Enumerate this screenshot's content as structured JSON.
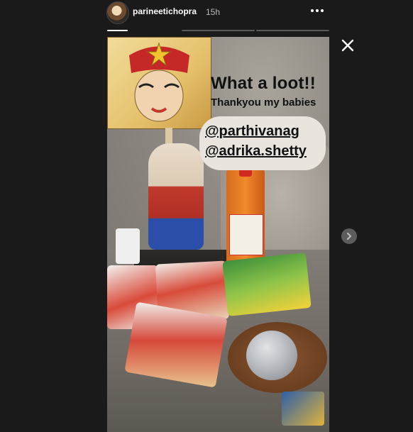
{
  "header": {
    "username": "parineetichopra",
    "time_ago": "15h",
    "more_icon": "more-horizontal-icon",
    "progress": [
      1.0,
      0.0,
      0.0
    ]
  },
  "controls": {
    "close_icon": "close-icon",
    "next_icon": "chevron-right-icon"
  },
  "story": {
    "caption": "What a loot!!",
    "subcaption": "Thankyou my babies",
    "mentions": [
      "@parthivanag",
      "@adrika.shetty"
    ]
  },
  "colors": {
    "background": "#1a1a1a",
    "progress_active": "#ffffff",
    "progress_inactive": "#5a5a5a"
  }
}
